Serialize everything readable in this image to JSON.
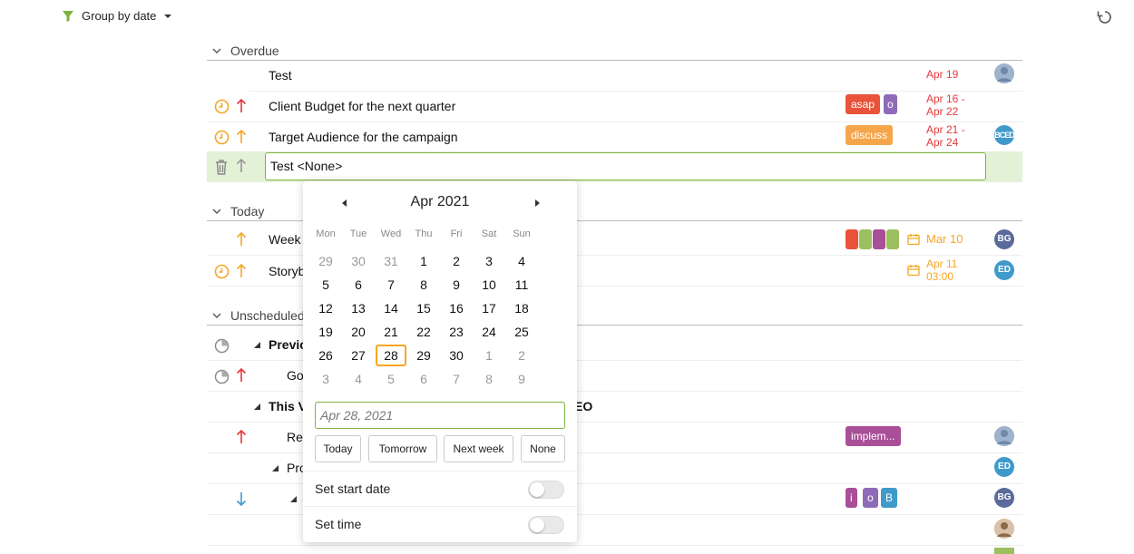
{
  "toolbar": {
    "group_label": "Group by date"
  },
  "sections": {
    "overdue": "Overdue",
    "today": "Today",
    "unscheduled": "Unscheduled"
  },
  "overdue_rows": [
    {
      "title": "Test",
      "date": "Apr 19"
    },
    {
      "title": "Client Budget for the next quarter",
      "tags": [
        "asap",
        "o"
      ],
      "date_line1": "Apr 16 -",
      "date_line2": "Apr 22"
    },
    {
      "title": "Target Audience for the campaign",
      "tags": [
        "discuss"
      ],
      "date_line1": "Apr 21 -",
      "date_line2": "Apr 24",
      "avatar": "BCED"
    }
  ],
  "editing_row": {
    "value": "Test <None>"
  },
  "today_rows": [
    {
      "title": "Week",
      "date": "Mar 10",
      "avatar": "BG"
    },
    {
      "title": "Storyb",
      "date_line1": "Apr 11",
      "date_line2": "03:00",
      "avatar": "ED"
    }
  ],
  "unscheduled_rows": [
    {
      "title": "Previc"
    },
    {
      "title": "Go"
    },
    {
      "title": "This V",
      "title_tail": "EO"
    },
    {
      "title": "Re",
      "tag": "implem..."
    },
    {
      "title": "Pro",
      "avatar": "ED"
    },
    {
      "tags": [
        "i",
        "o",
        "B"
      ],
      "avatar": "BG"
    }
  ],
  "calendar": {
    "month_label": "Apr 2021",
    "weekdays": [
      "Mon",
      "Tue",
      "Wed",
      "Thu",
      "Fri",
      "Sat",
      "Sun"
    ],
    "weeks": [
      [
        "29",
        "30",
        "31",
        "1",
        "2",
        "3",
        "4"
      ],
      [
        "5",
        "6",
        "7",
        "8",
        "9",
        "10",
        "11"
      ],
      [
        "12",
        "13",
        "14",
        "15",
        "16",
        "17",
        "18"
      ],
      [
        "19",
        "20",
        "21",
        "22",
        "23",
        "24",
        "25"
      ],
      [
        "26",
        "27",
        "28",
        "29",
        "30",
        "1",
        "2"
      ],
      [
        "3",
        "4",
        "5",
        "6",
        "7",
        "8",
        "9"
      ]
    ],
    "selected_day": "28",
    "input_placeholder": "Apr 28, 2021",
    "quick_buttons": [
      "Today",
      "Tomorrow",
      "Next week",
      "None"
    ],
    "set_start_date": "Set start date",
    "set_time": "Set time"
  },
  "colors": {
    "accent_green": "#7cb342",
    "red": "#e5383b",
    "orange": "#f5a623",
    "tag_asap": "#e8533a",
    "tag_o": "#8e6bb8",
    "tag_discuss": "#f5a64a",
    "tag_implem": "#a84f97",
    "avatar_blue": "#3f9ac9",
    "avatar_gray": "#5a6a9a"
  }
}
